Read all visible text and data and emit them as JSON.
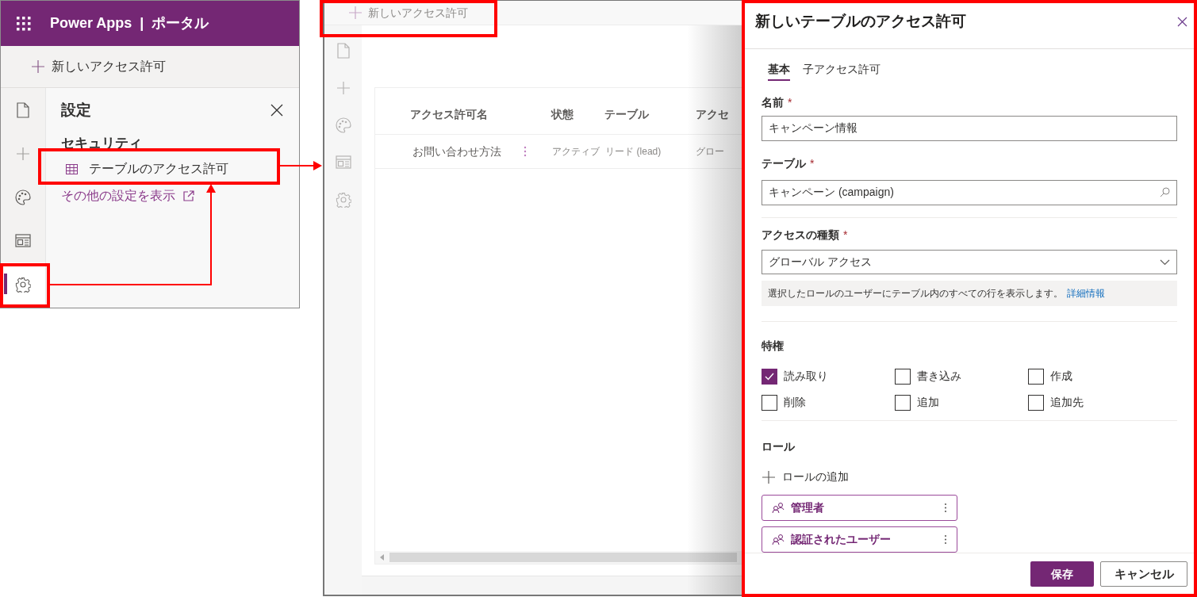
{
  "left_panel": {
    "header": {
      "app_name": "Power Apps",
      "divider": "|",
      "section": "ポータル"
    },
    "toolbar_button": "新しいアクセス許可",
    "rail": [
      {
        "kind": "page",
        "selected": false
      },
      {
        "kind": "add",
        "selected": false
      },
      {
        "kind": "palette",
        "selected": false
      },
      {
        "kind": "layout",
        "selected": false
      },
      {
        "kind": "settings",
        "selected": true
      }
    ],
    "settings": {
      "title": "設定",
      "section": "セキュリティ",
      "items": [
        {
          "label": "テーブルのアクセス許可"
        }
      ],
      "more_link": "その他の設定を表示"
    }
  },
  "background_view": {
    "toolbar_button": "新しいアクセス許可",
    "rail": [
      {
        "kind": "page"
      },
      {
        "kind": "add"
      },
      {
        "kind": "palette"
      },
      {
        "kind": "layout"
      },
      {
        "kind": "settings"
      }
    ],
    "table": {
      "columns": [
        "アクセス許可名",
        "状態",
        "テーブル",
        "アクセ"
      ],
      "rows": [
        {
          "cells": [
            "お問い合わせ方法",
            "アクティブ",
            "リード (lead)",
            "グロー"
          ]
        }
      ]
    }
  },
  "panel": {
    "title": "新しいテーブルのアクセス許可",
    "tabs": [
      {
        "label": "基本",
        "selected": true
      },
      {
        "label": "子アクセス許可",
        "selected": false
      }
    ],
    "name_field": {
      "label": "名前",
      "required_mark": "*",
      "value": "キャンペーン情報"
    },
    "table_field": {
      "label": "テーブル",
      "required_mark": "*",
      "value": "キャンペーン (campaign)"
    },
    "access_type": {
      "label": "アクセスの種類",
      "required_mark": "*",
      "value": "グローバル アクセス",
      "info": "選択したロールのユーザーにテーブル内のすべての行を表示します。",
      "info_link": "詳細情報"
    },
    "privileges": {
      "title": "特権",
      "items": [
        {
          "label": "読み取り",
          "checked": true
        },
        {
          "label": "書き込み",
          "checked": false
        },
        {
          "label": "作成",
          "checked": false
        },
        {
          "label": "削除",
          "checked": false
        },
        {
          "label": "追加",
          "checked": false
        },
        {
          "label": "追加先",
          "checked": false
        }
      ]
    },
    "roles": {
      "title": "ロール",
      "add_button": "ロールの追加",
      "items": [
        {
          "label": "管理者"
        },
        {
          "label": "認証されたユーザー"
        }
      ]
    },
    "buttons": {
      "save": "保存",
      "cancel": "キャンセル"
    }
  }
}
